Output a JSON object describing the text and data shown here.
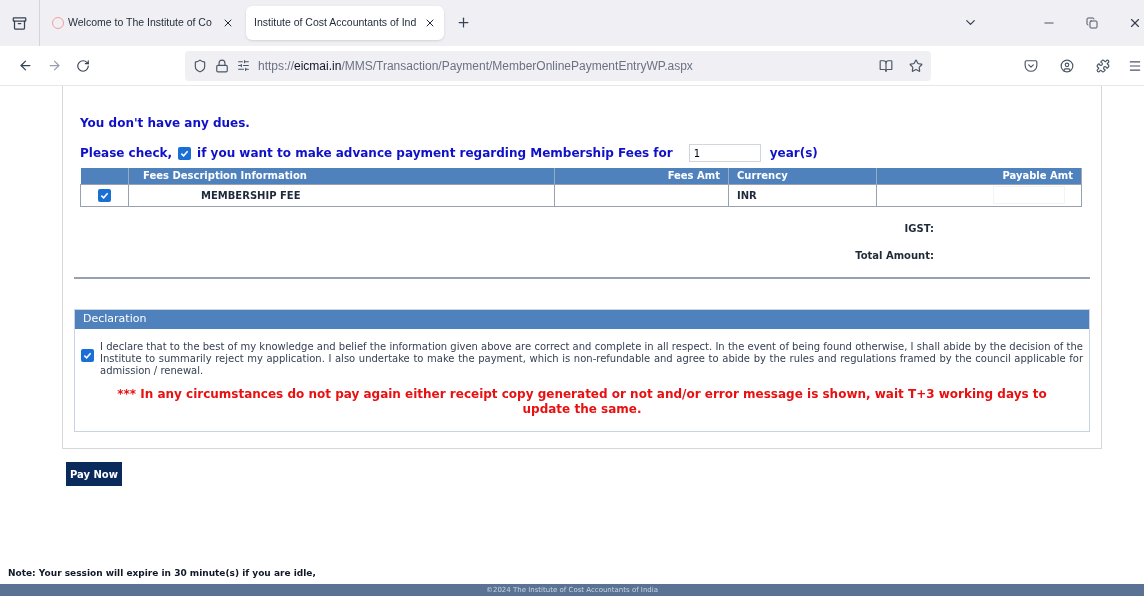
{
  "browser": {
    "tabs": [
      {
        "label": "Welcome to The Institute of Co",
        "selected": false
      },
      {
        "label": "Institute of Cost Accountants of Ind",
        "selected": true
      }
    ],
    "url": {
      "scheme": "https://",
      "domain": "eicmai.in",
      "path": "/MMS/Transaction/Payment/MemberOnlinePaymentEntryWP.aspx"
    }
  },
  "dues_message": "You don't have any dues.",
  "advance": {
    "before": "Please check,",
    "checked": true,
    "after": "if you want to make advance payment regarding Membership Fees for",
    "years": "1",
    "unit": "year(s)"
  },
  "table": {
    "columns": [
      "Fees Description Information",
      "Fees Amt",
      "Currency",
      "Payable Amt"
    ],
    "rows": [
      {
        "checked": true,
        "description": "MEMBERSHIP FEE",
        "currency": "INR"
      }
    ]
  },
  "totals": [
    "IGST:",
    "Total Amount:"
  ],
  "declaration": {
    "title": "Declaration",
    "checked": true,
    "text": "I declare that to the best of my knowledge and belief the information given above are correct and complete in all respect. In the event of being found otherwise, I shall abide by the decision of the Institute to summarily reject my application. I also undertake to make the payment, which is non-refundable and agree to abide by the rules and regulations framed by the council applicable for admission / renewal.",
    "warning": "*** In any circumstances do not pay again either receipt copy generated or not and/or error message is shown, wait T+3 working days to update the same."
  },
  "pay_button": "Pay Now",
  "note": "Note: Your session will expire in 30 minute(s) if you are idle,",
  "footer": "©2024 The Institute of Cost Accountants of India"
}
